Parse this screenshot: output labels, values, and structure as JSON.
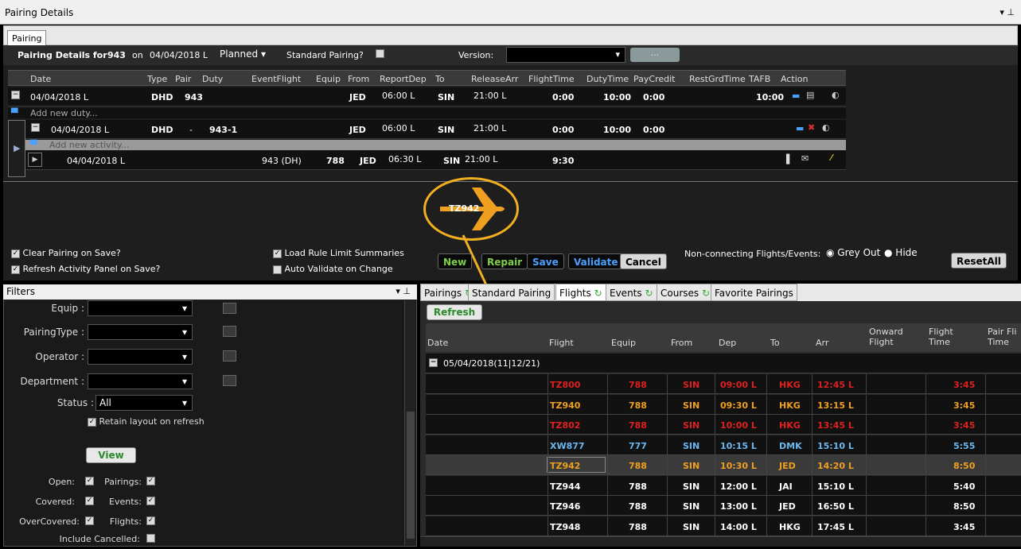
{
  "title": "Pairing Details",
  "title_controls": "▾ ⊥",
  "tab": "Pairing",
  "header": {
    "details_label": "Pairing Details for",
    "pairing_no": "943",
    "on_label": "on",
    "date": "04/04/2018 L",
    "status": "Planned",
    "standard_label": "Standard Pairing?",
    "version_label": "Version:",
    "ellipsis": "..."
  },
  "grid": {
    "columns": [
      "Date",
      "Type",
      "Pair",
      "Duty",
      "EventFlight",
      "Equip",
      "From",
      "ReportDep",
      "To",
      "ReleaseArr",
      "FlightTime",
      "DutyTime",
      "PayCredit",
      "RestGrdTime",
      "TAFB",
      "Action"
    ],
    "pairing_row": {
      "date": "04/04/2018 L",
      "type": "DHD",
      "pair": "943",
      "from": "JED",
      "reportdep": "06:00 L",
      "to": "SIN",
      "releasearr": "21:00 L",
      "flighttime": "0:00",
      "dutytime": "10:00",
      "paycredit": "0:00",
      "tafb": "10:00"
    },
    "add_duty": "Add new duty...",
    "duty_row": {
      "date": "04/04/2018 L",
      "type": "DHD",
      "pair": "-",
      "duty": "943-1",
      "from": "JED",
      "reportdep": "06:00 L",
      "to": "SIN",
      "releasearr": "21:00 L",
      "flighttime": "0:00",
      "dutytime": "10:00",
      "paycredit": "0:00"
    },
    "add_activity": "Add new activity...",
    "activity_row": {
      "date": "04/04/2018 L",
      "eventflight": "943 (DH)",
      "equip": "788",
      "from": "JED",
      "reportdep": "06:30 L",
      "to": "SIN",
      "releasearr": "21:00 L",
      "flighttime": "9:30"
    }
  },
  "plane_label": "TZ942",
  "options": {
    "clear_on_save": "Clear Pairing on Save?",
    "refresh_on_save": "Refresh Activity Panel on Save?",
    "load_rule": "Load Rule Limit Summaries",
    "auto_validate": "Auto Validate on Change",
    "nonconnecting": "Non-connecting Flights/Events:",
    "grey_out": "Grey Out",
    "hide": "Hide"
  },
  "buttons": {
    "new": "New",
    "repair": "Repair",
    "save": "Save",
    "validate": "Validate",
    "cancel": "Cancel",
    "resetall": "ResetAll",
    "refresh": "Refresh",
    "view": "View"
  },
  "filters": {
    "title": "Filters",
    "equip": "Equip :",
    "pairing_type": "PairingType :",
    "operator": "Operator :",
    "department": "Department :",
    "status": "Status :",
    "status_value": "All",
    "retain": "Retain layout on refresh",
    "open": "Open:",
    "pairings": "Pairings:",
    "covered": "Covered:",
    "events": "Events:",
    "overcovered": "OverCovered:",
    "flights": "Flights:",
    "include_cancelled": "Include Cancelled:"
  },
  "right_tabs": [
    "Pairings",
    "Standard Pairing",
    "Flights",
    "Events",
    "Courses",
    "Favorite Pairings"
  ],
  "flights_grid": {
    "columns": [
      "Date",
      "Flight",
      "Equip",
      "From",
      "Dep",
      "To",
      "Arr",
      "Onward Flight",
      "Flight Time",
      "Pair Fli Time"
    ],
    "group": "05/04/2018(11|12/21)",
    "rows": [
      {
        "flight": "TZ800",
        "equip": "788",
        "from": "SIN",
        "dep": "09:00 L",
        "to": "HKG",
        "arr": "12:45 L",
        "time": "3:45",
        "color": "#e02020"
      },
      {
        "flight": "TZ940",
        "equip": "788",
        "from": "SIN",
        "dep": "09:30 L",
        "to": "HKG",
        "arr": "13:15 L",
        "time": "3:45",
        "color": "#f0a020"
      },
      {
        "flight": "TZ802",
        "equip": "788",
        "from": "SIN",
        "dep": "10:00 L",
        "to": "HKG",
        "arr": "13:45 L",
        "time": "3:45",
        "color": "#e02020"
      },
      {
        "flight": "XW877",
        "equip": "777",
        "from": "SIN",
        "dep": "10:15 L",
        "to": "DMK",
        "arr": "15:10 L",
        "time": "5:55",
        "color": "#6ab8f0"
      },
      {
        "flight": "TZ942",
        "equip": "788",
        "from": "SIN",
        "dep": "10:30 L",
        "to": "JED",
        "arr": "14:20 L",
        "time": "8:50",
        "color": "#f0a020"
      },
      {
        "flight": "TZ944",
        "equip": "788",
        "from": "SIN",
        "dep": "12:00 L",
        "to": "JAI",
        "arr": "15:10 L",
        "time": "5:40",
        "color": "#ffffff"
      },
      {
        "flight": "TZ946",
        "equip": "788",
        "from": "SIN",
        "dep": "13:00 L",
        "to": "JED",
        "arr": "16:50 L",
        "time": "8:50",
        "color": "#ffffff"
      },
      {
        "flight": "TZ948",
        "equip": "788",
        "from": "SIN",
        "dep": "14:00 L",
        "to": "HKG",
        "arr": "17:45 L",
        "time": "3:45",
        "color": "#ffffff"
      }
    ]
  }
}
